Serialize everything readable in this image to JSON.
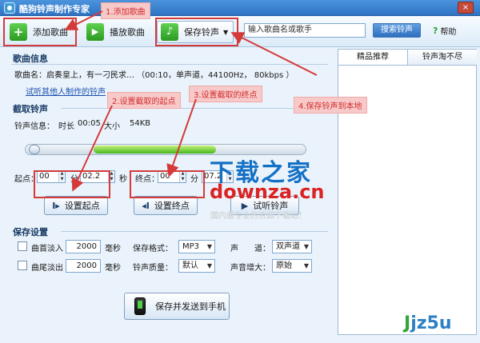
{
  "window": {
    "title": "酷狗铃声制作专家",
    "close_glyph": "×"
  },
  "toolbar": {
    "add_song_label": "添加歌曲",
    "add_song_glyph": "+",
    "play_song_label": "播放歌曲",
    "play_song_glyph": "▶",
    "save_ring_label": "保存铃声",
    "save_ring_glyph": "♪",
    "save_ring_caret": "▼",
    "search_placeholder": "输入歌曲名或歌手",
    "search_button_label": "搜索铃声",
    "help_glyph": "?",
    "help_label": "帮助"
  },
  "song_info": {
    "section_title": "歌曲信息",
    "song_name_line": "歌曲名：启奏皇上，有一刁民求…  （00:10，单声道，44100Hz，  80kbps ）",
    "others_link": "试听其他人制作的铃声"
  },
  "clip": {
    "section_title": "截取铃声",
    "ring_info_label": "铃声信息：",
    "duration_label": "时长",
    "duration_value": "00:05",
    "size_label": "大小",
    "size_value": "54KB",
    "slider_progress": 0.6,
    "start_label": "起点：",
    "start_min": "00",
    "start_min_unit": "分",
    "start_sec": "02.2",
    "start_sec_unit": "秒",
    "end_label": "终点：",
    "end_min": "00",
    "end_min_unit": "分",
    "end_sec": "07.2",
    "set_start_label": "设置起点",
    "set_start_glyph": "I▸",
    "set_end_label": "设置终点",
    "set_end_glyph": "◂I",
    "preview_label": "试听铃声",
    "preview_glyph": "▶"
  },
  "save_settings": {
    "section_title": "保存设置",
    "fade_in_label": "曲首淡入",
    "fade_in_value": "2000",
    "fade_in_unit": "毫秒",
    "fade_out_label": "曲尾淡出",
    "fade_out_value": "2000",
    "fade_out_unit": "毫秒",
    "format_label": "保存格式：",
    "format_value": "MP3",
    "quality_label": "铃声质量：",
    "quality_value": "默认",
    "channel_label": "声　　道：",
    "channel_value": "双声道",
    "volume_label": "声音增大：",
    "volume_value": "原始",
    "dropdown_caret": "▼",
    "send_to_phone_label": "保存并发送到手机"
  },
  "right_panel": {
    "tabs": [
      "精品推荐",
      "铃声淘不尽"
    ]
  },
  "annotations": {
    "step1": "1.添加歌曲",
    "step2": "2.设置截取的起点",
    "step3": "3.设置截取的终点",
    "step4": "4.保存铃声到本地",
    "accent_color": "#d43a3a"
  },
  "watermark": {
    "title": "下载之家",
    "url": "downza.cn",
    "subtitle": "国内最专业的资源下载站！",
    "logo_j": "J",
    "logo_rest": "jz5u"
  }
}
